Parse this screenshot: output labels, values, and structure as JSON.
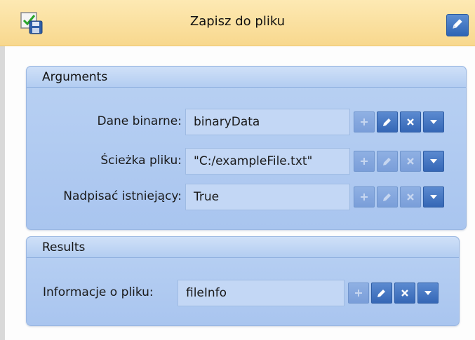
{
  "header": {
    "title": "Zapisz do pliku",
    "icon": "save-to-file-icon",
    "edit_icon": "pencil-icon"
  },
  "arguments": {
    "title": "Arguments",
    "rows": [
      {
        "label": "Dane binarne:",
        "value": "binaryData",
        "add_enabled": false,
        "edit_enabled": true,
        "clear_enabled": true
      },
      {
        "label": "Ścieżka pliku:",
        "value": "\"C:/exampleFile.txt\"",
        "add_enabled": false,
        "edit_enabled": false,
        "clear_enabled": false
      },
      {
        "label": "Nadpisać istniejący:",
        "value": "True",
        "add_enabled": false,
        "edit_enabled": false,
        "clear_enabled": false
      }
    ]
  },
  "results": {
    "title": "Results",
    "rows": [
      {
        "label": "Informacje o pliku:",
        "value": "fileInfo",
        "add_enabled": false,
        "edit_enabled": true,
        "clear_enabled": true
      }
    ]
  },
  "colors": {
    "header_bg": "#f8d88e",
    "group_bg": "#a9c5ef",
    "button_blue": "#3567b6"
  }
}
